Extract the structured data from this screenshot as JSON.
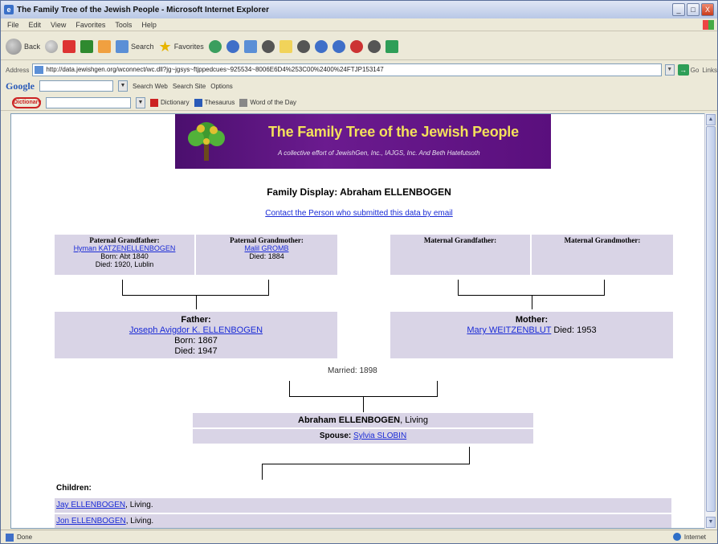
{
  "window": {
    "title": "The Family Tree of the Jewish People - Microsoft Internet Explorer",
    "controls": [
      "_",
      "□",
      "X"
    ]
  },
  "menu": [
    "File",
    "Edit",
    "View",
    "Favorites",
    "Tools",
    "Help"
  ],
  "toolbar": {
    "back": "Back",
    "search": "Search",
    "favorites": "Favorites"
  },
  "address": {
    "label": "Address",
    "url": "http://data.jewishgen.org/wconnect/wc.dll?jg~jgsys~ftjppedcues~925534~8006E6D4%253C00%2400%24FTJP153147",
    "go": "Go",
    "links": "Links"
  },
  "google": {
    "logo": "Google",
    "search_web": "Search Web",
    "search_site": "Search Site",
    "options": "Options"
  },
  "dict": {
    "logo": "Dictionary",
    "dictionary": "Dictionary",
    "thesaurus": "Thesaurus",
    "word_of_day": "Word of the Day"
  },
  "banner": {
    "title": "The Family Tree of the Jewish People",
    "subtitle": "A collective effort of JewishGen, Inc., IAJGS, Inc. And Beth Hatefutsoth"
  },
  "heading": "Family Display: Abraham ELLENBOGEN",
  "contact_link": "Contact the Person who submitted this data by email",
  "paternal_grandfather": {
    "label": "Paternal Grandfather:",
    "name": "Hyman KATZENELLENBOGEN",
    "born": "Born: Abt 1840",
    "died": "Died: 1920, Lublin"
  },
  "paternal_grandmother": {
    "label": "Paternal Grandmother:",
    "name": "Malil GROMB",
    "died": "Died: 1884"
  },
  "maternal_grandfather": {
    "label": "Maternal Grandfather:"
  },
  "maternal_grandmother": {
    "label": "Maternal Grandmother:"
  },
  "father": {
    "label": "Father:",
    "name": "Joseph Avigdor K. ELLENBOGEN",
    "born": "Born: 1867",
    "died": "Died: 1947"
  },
  "mother": {
    "label": "Mother:",
    "name": "Mary WEITZENBLUT",
    "died": "Died: 1953"
  },
  "married": "Married: 1898",
  "self": {
    "name": "Abraham ELLENBOGEN",
    "status": ", Living",
    "spouse_label": "Spouse:",
    "spouse_name": "Sylvia SLOBIN"
  },
  "children_label": "Children:",
  "children": [
    {
      "name": "Jay ELLENBOGEN",
      "status": ", Living."
    },
    {
      "name": "Jon ELLENBOGEN",
      "status": ", Living."
    }
  ],
  "status": {
    "left": "Done",
    "zone": "Internet"
  }
}
